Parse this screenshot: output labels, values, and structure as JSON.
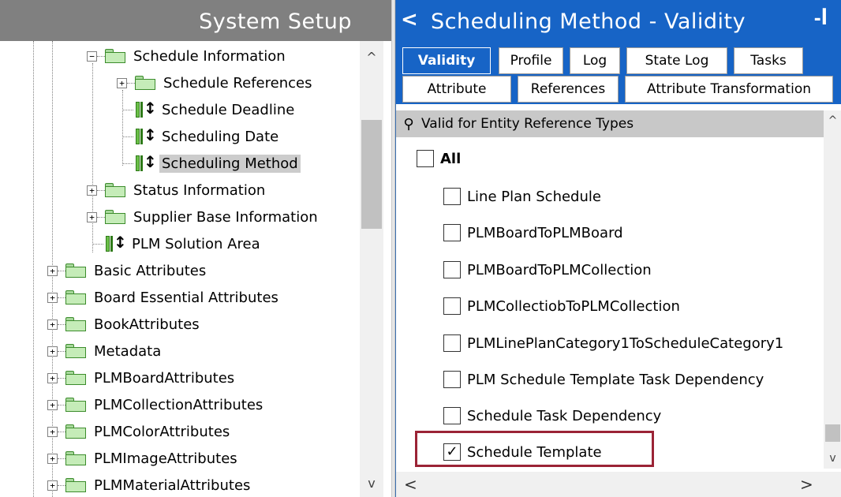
{
  "left": {
    "title": "System Setup",
    "tree": [
      {
        "label": "Schedule Information",
        "type": "folder",
        "expander": "−"
      },
      {
        "label": "Schedule References",
        "type": "folder",
        "expander": "+"
      },
      {
        "label": "Schedule Deadline",
        "type": "attribute"
      },
      {
        "label": "Scheduling Date",
        "type": "attribute"
      },
      {
        "label": "Scheduling Method",
        "type": "attribute",
        "selected": true
      },
      {
        "label": "Status Information",
        "type": "folder",
        "expander": "+"
      },
      {
        "label": "Supplier Base Information",
        "type": "folder",
        "expander": "+"
      },
      {
        "label": "PLM Solution Area",
        "type": "attribute"
      },
      {
        "label": "Basic Attributes",
        "type": "folder",
        "expander": "+"
      },
      {
        "label": "Board Essential Attributes",
        "type": "folder",
        "expander": "+"
      },
      {
        "label": "BookAttributes",
        "type": "folder",
        "expander": "+"
      },
      {
        "label": "Metadata",
        "type": "folder",
        "expander": "+"
      },
      {
        "label": "PLMBoardAttributes",
        "type": "folder",
        "expander": "+"
      },
      {
        "label": "PLMCollectionAttributes",
        "type": "folder",
        "expander": "+"
      },
      {
        "label": "PLMColorAttributes",
        "type": "folder",
        "expander": "+"
      },
      {
        "label": "PLMImageAttributes",
        "type": "folder",
        "expander": "+"
      },
      {
        "label": "PLMMaterialAttributes",
        "type": "folder",
        "expander": "+"
      }
    ],
    "scroll_up": "^",
    "scroll_down": "v"
  },
  "right": {
    "back_glyph": "<",
    "title": "Scheduling Method - Validity",
    "pin_glyph": "-ꟾ",
    "tabs_row1": [
      {
        "label": "Validity",
        "active": true
      },
      {
        "label": "Profile"
      },
      {
        "label": "Log"
      },
      {
        "label": "State Log"
      },
      {
        "label": "Tasks"
      }
    ],
    "tabs_row2": [
      {
        "label": "Attribute"
      },
      {
        "label": "References"
      },
      {
        "label": "Attribute Transformation"
      }
    ],
    "section_title": "Valid for Entity Reference Types",
    "section_pin_glyph": "⚲",
    "all_label": "All",
    "checkbox_items": [
      {
        "label": "Line Plan Schedule",
        "checked": false
      },
      {
        "label": "PLMBoardToPLMBoard",
        "checked": false
      },
      {
        "label": "PLMBoardToPLMCollection",
        "checked": false
      },
      {
        "label": "PLMCollectiobToPLMCollection",
        "checked": false
      },
      {
        "label": "PLMLinePlanCategory1ToScheduleCategory1",
        "checked": false
      },
      {
        "label": "PLM Schedule Template Task Dependency",
        "checked": false
      },
      {
        "label": "Schedule Task Dependency",
        "checked": false
      },
      {
        "label": "Schedule Template",
        "checked": true
      }
    ],
    "scroll_left": "<",
    "scroll_right": ">",
    "scroll_up": "^",
    "scroll_down": "v"
  },
  "colors": {
    "header_blue": "#1764c6",
    "header_gray": "#808080",
    "highlight_border": "#9b2335",
    "folder_green": "#c5ecb8"
  }
}
